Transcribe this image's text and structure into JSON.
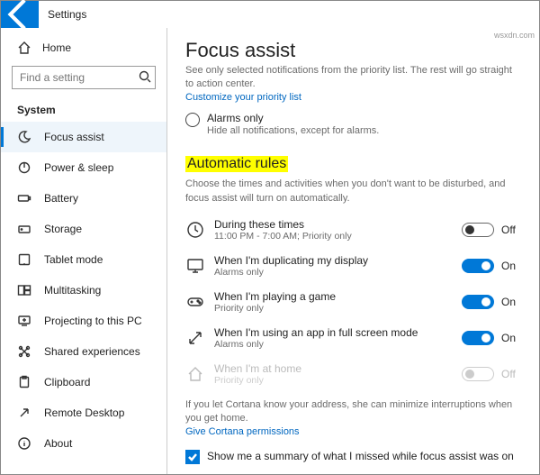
{
  "titlebar": {
    "label": "Settings"
  },
  "sidebar": {
    "home": "Home",
    "search_placeholder": "Find a setting",
    "section": "System",
    "items": [
      {
        "label": "Focus assist"
      },
      {
        "label": "Power & sleep"
      },
      {
        "label": "Battery"
      },
      {
        "label": "Storage"
      },
      {
        "label": "Tablet mode"
      },
      {
        "label": "Multitasking"
      },
      {
        "label": "Projecting to this PC"
      },
      {
        "label": "Shared experiences"
      },
      {
        "label": "Clipboard"
      },
      {
        "label": "Remote Desktop"
      },
      {
        "label": "About"
      }
    ]
  },
  "main": {
    "title": "Focus assist",
    "priority_desc": "See only selected notifications from the priority list. The rest will go straight to action center.",
    "priority_link": "Customize your priority list",
    "radio": {
      "label": "Alarms only",
      "sub": "Hide all notifications, except for alarms."
    },
    "rules_heading": "Automatic rules",
    "rules_desc": "Choose the times and activities when you don't want to be disturbed, and focus assist will turn on automatically.",
    "rules": [
      {
        "title": "During these times",
        "sub": "11:00 PM - 7:00 AM; Priority only",
        "state": "Off",
        "on": false,
        "disabled": false
      },
      {
        "title": "When I'm duplicating my display",
        "sub": "Alarms only",
        "state": "On",
        "on": true,
        "disabled": false
      },
      {
        "title": "When I'm playing a game",
        "sub": "Priority only",
        "state": "On",
        "on": true,
        "disabled": false
      },
      {
        "title": "When I'm using an app in full screen mode",
        "sub": "Alarms only",
        "state": "On",
        "on": true,
        "disabled": false
      },
      {
        "title": "When I'm at home",
        "sub": "Priority only",
        "state": "Off",
        "on": false,
        "disabled": true
      }
    ],
    "cortana_desc": "If you let Cortana know your address, she can minimize interruptions when you get home.",
    "cortana_link": "Give Cortana permissions",
    "summary_checkbox": "Show me a summary of what I missed while focus assist was on"
  },
  "watermark": "wsxdn.com"
}
